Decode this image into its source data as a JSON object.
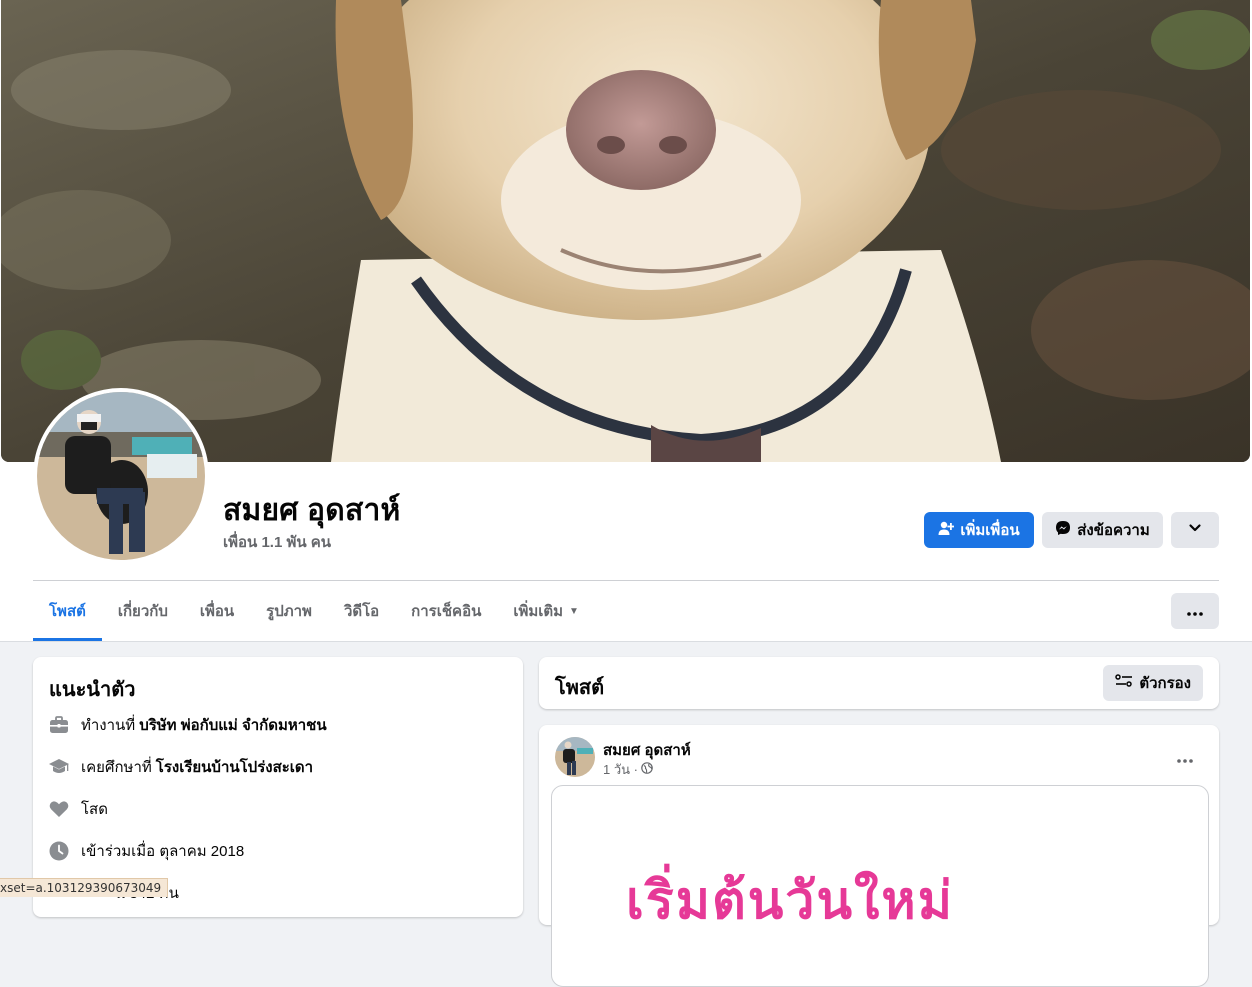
{
  "profile": {
    "name": "สมยศ อุดสาห์",
    "friends_count": "เพื่อน 1.1 พัน คน"
  },
  "actions": {
    "add_friend": "เพิ่มเพื่อน",
    "message": "ส่งข้อความ"
  },
  "tabs": [
    {
      "label": "โพสต์"
    },
    {
      "label": "เกี่ยวกับ"
    },
    {
      "label": "เพื่อน"
    },
    {
      "label": "รูปภาพ"
    },
    {
      "label": "วิดีโอ"
    },
    {
      "label": "การเช็คอิน"
    },
    {
      "label": "เพิ่มเติม"
    }
  ],
  "intro": {
    "title": "แนะนำตัว",
    "work_prefix": "ทำงานที่",
    "work_place": "บริษัท พ่อกับแม่ จำกัดมหาชน",
    "study_prefix": "เคยศึกษาที่",
    "study_place": "โรงเรียนบ้านโปร่งสะเดา",
    "relationship": "โสด",
    "joined": "เข้าร่วมเมื่อ ตุลาคม 2018",
    "followers_partial": "น 342 คน"
  },
  "posts": {
    "title": "โพสต์",
    "filter_label": "ตัวกรอง",
    "post": {
      "author": "สมยศ อุดสาห์",
      "time": "1 วัน ·",
      "image_text": "เริ่มต้นวันใหม่"
    }
  },
  "status_bar": {
    "url": "xset=a.103129390673049"
  },
  "colors": {
    "accent": "#1b74e4",
    "button_grey": "#e4e6eb",
    "page_bg": "#f0f2f5",
    "image_text": "#e63997"
  }
}
